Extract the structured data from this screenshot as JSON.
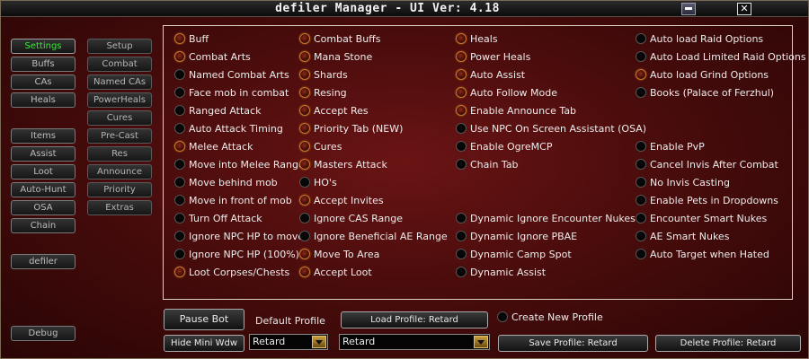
{
  "window": {
    "title": "defiler Manager  - UI Ver: 4.18"
  },
  "nav_left": [
    {
      "label": "Settings",
      "active": true
    },
    {
      "label": "Buffs"
    },
    {
      "label": "CAs"
    },
    {
      "label": "Heals"
    },
    {
      "label": "Items"
    },
    {
      "label": "Assist"
    },
    {
      "label": "Loot"
    },
    {
      "label": "Auto-Hunt"
    },
    {
      "label": "OSA"
    },
    {
      "label": "Chain"
    },
    {
      "label": "defiler"
    },
    {
      "label": "Debug"
    }
  ],
  "nav_right": [
    {
      "label": "Setup"
    },
    {
      "label": "Combat"
    },
    {
      "label": "Named CAs"
    },
    {
      "label": "PowerHeals"
    },
    {
      "label": "Cures"
    },
    {
      "label": "Pre-Cast"
    },
    {
      "label": "Res"
    },
    {
      "label": "Announce"
    },
    {
      "label": "Priority"
    },
    {
      "label": "Extras"
    }
  ],
  "options": {
    "col1": [
      {
        "label": "Buff",
        "on": true
      },
      {
        "label": "Combat Arts",
        "on": true
      },
      {
        "label": "Named Combat Arts",
        "on": false
      },
      {
        "label": "Face mob in combat",
        "on": false
      },
      {
        "label": "Ranged Attack",
        "on": false
      },
      {
        "label": "Auto Attack Timing",
        "on": false
      },
      {
        "label": "Melee Attack",
        "on": true
      },
      {
        "label": "Move into Melee Range",
        "on": false
      },
      {
        "label": "Move behind mob",
        "on": false
      },
      {
        "label": "Move in front of mob",
        "on": false
      },
      {
        "label": "Turn Off Attack",
        "on": false
      },
      {
        "label": "Ignore NPC HP to move",
        "on": false
      },
      {
        "label": "Ignore NPC HP (100%)",
        "on": false
      },
      {
        "label": "Loot Corpses/Chests",
        "on": true
      }
    ],
    "col2": [
      {
        "label": "Combat Buffs",
        "on": true
      },
      {
        "label": "Mana Stone",
        "on": true
      },
      {
        "label": "Shards",
        "on": true
      },
      {
        "label": "Resing",
        "on": true
      },
      {
        "label": "Accept Res",
        "on": true
      },
      {
        "label": "Priority Tab (NEW)",
        "on": true
      },
      {
        "label": "Cures",
        "on": true
      },
      {
        "label": "Masters Attack",
        "on": true
      },
      {
        "label": "HO's",
        "on": false
      },
      {
        "label": "Accept Invites",
        "on": true
      },
      {
        "label": "Ignore CAS Range",
        "on": false
      },
      {
        "label": "Ignore Beneficial AE Range",
        "on": false
      },
      {
        "label": "Move To Area",
        "on": true
      },
      {
        "label": "Accept Loot",
        "on": true
      }
    ],
    "col3": [
      {
        "label": "Heals",
        "on": true,
        "row": 0
      },
      {
        "label": "Power Heals",
        "on": true,
        "row": 1
      },
      {
        "label": "Auto Assist",
        "on": true,
        "row": 2
      },
      {
        "label": "Auto Follow Mode",
        "on": true,
        "row": 3
      },
      {
        "label": "Enable Announce Tab",
        "on": true,
        "row": 4
      },
      {
        "label": "Use NPC On Screen Assistant (OSA)",
        "on": false,
        "row": 5
      },
      {
        "label": "Enable OgreMCP",
        "on": false,
        "row": 6
      },
      {
        "label": "Chain Tab",
        "on": false,
        "row": 7
      },
      {
        "label": "Dynamic Ignore Encounter Nukes",
        "on": false,
        "row": 10
      },
      {
        "label": "Dynamic Ignore PBAE",
        "on": false,
        "row": 11
      },
      {
        "label": "Dynamic Camp Spot",
        "on": false,
        "row": 12
      },
      {
        "label": "Dynamic Assist",
        "on": false,
        "row": 13
      }
    ],
    "col4": [
      {
        "label": "Auto load Raid Options",
        "on": false,
        "row": 0
      },
      {
        "label": "Auto Load Limited Raid Options",
        "on": false,
        "row": 1
      },
      {
        "label": "Auto load Grind Options",
        "on": true,
        "row": 2
      },
      {
        "label": "Books (Palace of Ferzhul)",
        "on": false,
        "row": 3
      },
      {
        "label": "Enable PvP",
        "on": false,
        "row": 6
      },
      {
        "label": "Cancel Invis After Combat",
        "on": false,
        "row": 7
      },
      {
        "label": "No Invis Casting",
        "on": false,
        "row": 8
      },
      {
        "label": "Enable Pets in Dropdowns",
        "on": false,
        "row": 9
      },
      {
        "label": "Encounter Smart Nukes",
        "on": false,
        "row": 10
      },
      {
        "label": "AE Smart Nukes",
        "on": false,
        "row": 11
      },
      {
        "label": "Auto Target when Hated",
        "on": false,
        "row": 12
      }
    ]
  },
  "bottom": {
    "pause_label": "Pause Bot",
    "hide_mini_label": "Hide Mini Wdw",
    "default_profile_label": "Default Profile",
    "default_profile_value": "Retard",
    "load_profile_label": "Load Profile: Retard",
    "profile_select_value": "Retard",
    "create_new_profile_label": "Create New Profile",
    "save_profile_label": "Save Profile: Retard",
    "delete_profile_label": "Delete Profile: Retard"
  }
}
